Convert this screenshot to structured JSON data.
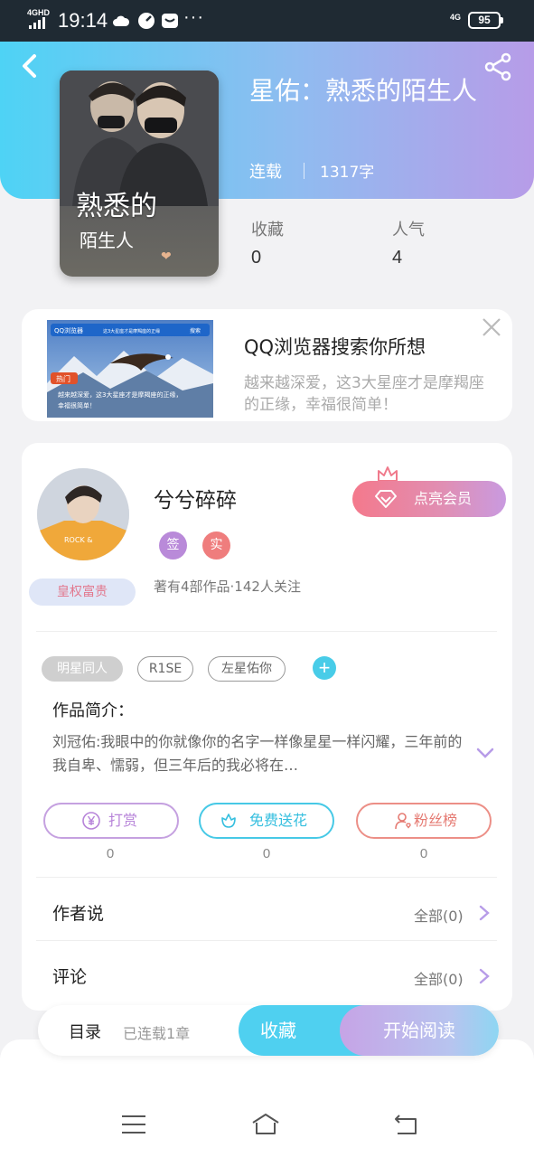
{
  "status_bar": {
    "network": "4GHD",
    "time": "19:14",
    "icons": [
      "cloud-icon",
      "speed-icon",
      "mail-icon"
    ],
    "more": "···",
    "signal": "4G",
    "battery": "95"
  },
  "book": {
    "title": "星佑：熟悉的陌生人",
    "status": "连载",
    "word_count": "1317字",
    "cover_title": "熟悉的",
    "cover_subtitle": "陌生人",
    "stats": [
      {
        "label": "收藏",
        "value": "0"
      },
      {
        "label": "人气",
        "value": "4"
      }
    ]
  },
  "ad": {
    "title": "QQ浏览器搜索你所想",
    "description": "越来越深爱，这3大星座才是摩羯座\n的正缘，幸福很简单！",
    "image_brand": "QQ浏览器",
    "image_search_text": "这3大星座才是摩羯座的正缘",
    "image_search_button": "搜索",
    "image_hot": "热门",
    "image_caption": "越来越深爱，这3大星座才是摩羯座的正缘，\n幸福很简单！"
  },
  "author": {
    "name": "兮兮碎碎",
    "rank_badge": "皇权富贵",
    "tags": [
      "签",
      "实"
    ],
    "stats": "著有4部作品·142人关注",
    "vip_button": "点亮会员"
  },
  "book_tags": [
    "明星同人",
    "R1SE",
    "左星佑你"
  ],
  "tag_add": "+",
  "intro": {
    "label": "作品简介：",
    "text": "刘冠佑:我眼中的你就像你的名字一样像星星一样闪耀，三年前的我自卑、懦弱，但三年后的我必将在…"
  },
  "actions": [
    {
      "label": "打赏",
      "count": "0",
      "icon": "yen-coin-icon",
      "color": "#b784d9"
    },
    {
      "label": "免费送花",
      "count": "0",
      "icon": "flower-icon",
      "color": "#3cc6e4"
    },
    {
      "label": "粉丝榜",
      "count": "0",
      "icon": "fan-user-icon",
      "color": "#e98078"
    }
  ],
  "rows": [
    {
      "label": "作者说",
      "value": "全部(0)"
    },
    {
      "label": "评论",
      "value": "全部(0)"
    }
  ],
  "bottom_bar": {
    "toc": "目录",
    "toc_sub": "已连载1章",
    "collect": "收藏",
    "read": "开始阅读"
  },
  "colors": {
    "accent_cyan": "#4fd0f0",
    "accent_purple": "#b79ce8",
    "vip_pink": "#f4798c"
  }
}
